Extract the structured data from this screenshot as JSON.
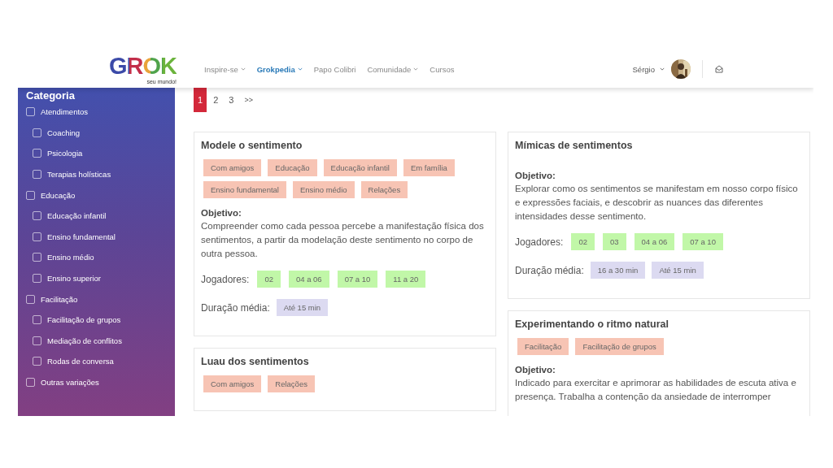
{
  "header": {
    "logo": {
      "name": "GROK",
      "tagline": "seu mundo!"
    },
    "nav": [
      {
        "label": "Inspire-se",
        "dropdown": true,
        "selected": false
      },
      {
        "label": "Grokpedia",
        "dropdown": true,
        "selected": true
      },
      {
        "label": "Papo Colibri",
        "dropdown": false,
        "selected": false
      },
      {
        "label": "Comunidade",
        "dropdown": true,
        "selected": false
      },
      {
        "label": "Cursos",
        "dropdown": false,
        "selected": false
      }
    ],
    "user": {
      "name": "Sérgio"
    }
  },
  "sidebar": {
    "title": "Categoria",
    "items": [
      {
        "label": "Atendimentos",
        "checked": false,
        "children": [
          {
            "label": "Coaching",
            "checked": false
          },
          {
            "label": "Psicologia",
            "checked": false
          },
          {
            "label": "Terapias holísticas",
            "checked": false
          }
        ]
      },
      {
        "label": "Educação",
        "checked": false,
        "children": [
          {
            "label": "Educação infantil",
            "checked": false
          },
          {
            "label": "Ensino fundamental",
            "checked": false
          },
          {
            "label": "Ensino médio",
            "checked": false
          },
          {
            "label": "Ensino superior",
            "checked": false
          }
        ]
      },
      {
        "label": "Facilitação",
        "checked": false,
        "children": [
          {
            "label": "Facilitação de grupos",
            "checked": false
          },
          {
            "label": "Mediação de conflitos",
            "checked": false
          },
          {
            "label": "Rodas de conversa",
            "checked": false
          }
        ]
      },
      {
        "label": "Outras variações",
        "checked": false
      }
    ]
  },
  "pagination": {
    "pages": [
      {
        "label": "1",
        "selected": true
      },
      {
        "label": "2",
        "selected": false
      },
      {
        "label": "3",
        "selected": false
      }
    ],
    "next": ">>"
  },
  "columns": [
    {
      "cards": [
        {
          "title": "Modele o sentimento",
          "tags": [
            "Com amigos",
            "Educação",
            "Educação infantil",
            "Em família",
            "Ensino fundamental",
            "Ensino médio",
            "Relações"
          ],
          "objective_label": "Objetivo:",
          "objective": "Compreender como cada pessoa percebe a manifestação física dos sentimentos, a partir da modelação deste sentimento no corpo de outra pessoa.",
          "players_label": "Jogadores:",
          "players": [
            "02",
            "04 a 06",
            "07 a 10",
            "11 a 20"
          ],
          "duration_label": "Duração média:",
          "durations": [
            "Até 15 min"
          ]
        },
        {
          "title": "Luau dos sentimentos",
          "tags": [
            "Com amigos",
            "Relações"
          ]
        }
      ]
    },
    {
      "cards": [
        {
          "title": "Mímicas de sentimentos",
          "objective_label": "Objetivo:",
          "objective": "Explorar como os sentimentos se manifestam em nosso corpo físico e expressões faciais, e descobrir as nuances das diferentes intensidades desse sentimento.",
          "players_label": "Jogadores:",
          "players": [
            "02",
            "03",
            "04 a 06",
            "07 a 10"
          ],
          "duration_label": "Duração média:",
          "durations": [
            "16 a 30 min",
            "Até 15 min"
          ]
        },
        {
          "title": "Experimentando o ritmo natural",
          "tags": [
            "Facilitação",
            "Facilitação de grupos"
          ],
          "objective_label": "Objetivo:",
          "objective": "Indicado para exercitar e aprimorar as habilidades de escuta ativa e presença. Trabalha a contenção da ansiedade de interromper"
        }
      ]
    }
  ]
}
